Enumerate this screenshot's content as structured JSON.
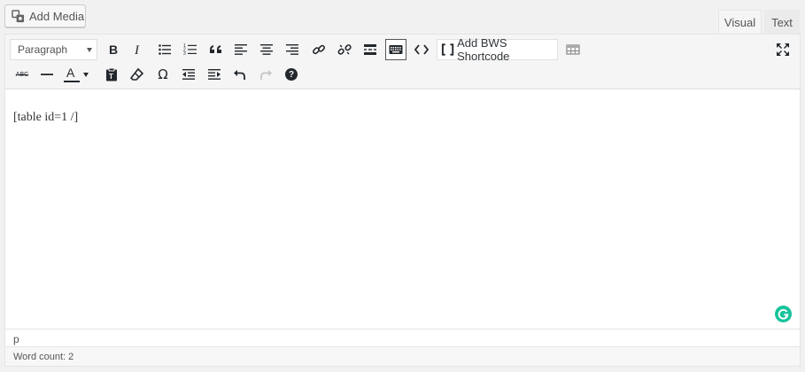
{
  "add_media": {
    "label": "Add Media"
  },
  "tabs": {
    "visual": "Visual",
    "text": "Text"
  },
  "toolbar": {
    "format_select": "Paragraph",
    "shortcode_label": "Add BWS Shortcode",
    "strikethrough_label": "ABC",
    "text_color_label": "A",
    "omega_label": "Ω",
    "help_label": "?"
  },
  "content": {
    "text": "[table id=1 /]"
  },
  "status": {
    "path": "p",
    "word_count": "Word count: 2"
  },
  "colors": {
    "grammarly": "#15c39a",
    "toolbar_bg": "#f5f5f5"
  }
}
